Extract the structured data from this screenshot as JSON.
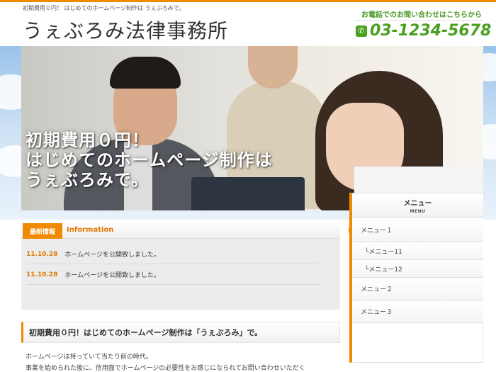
{
  "header": {
    "tagline": "初期費用０円！ はじめてのホームページ制作は うぇぶろみで。",
    "site_title": "うぇぶろみ法律事務所",
    "contact_label": "お電話でのお問い合わせはこちらから",
    "phone_number": "03-1234-5678",
    "phone_icon": "phone-icon"
  },
  "hero": {
    "line1": "初期費用０円！",
    "line2": "はじめてのホームページ制作は",
    "line3": "うぇぶろみで。"
  },
  "news": {
    "tag": "最新情報",
    "subtitle": "Information",
    "items": [
      {
        "date": "11.10.28",
        "text": "ホームページを公開致しました。"
      },
      {
        "date": "11.10.28",
        "text": "ホームページを公開致しました。"
      }
    ]
  },
  "intro": {
    "heading": "初期費用０円！はじめてのホームページ制作は「うぇぶろみ」で。",
    "line1": "ホームページは持っていて当たり前の時代。",
    "line2": "事業を始められた後に、信用面でホームページの必要性をお感じになられてお問い合わせいただく"
  },
  "sidebar": {
    "title": "メニュー",
    "subtitle": "MENU",
    "items": [
      {
        "label": "メニュー１"
      },
      {
        "label": "└メニュー11"
      },
      {
        "label": "└メニュー12"
      },
      {
        "label": "メニュー２"
      },
      {
        "label": "メニュー３"
      }
    ]
  },
  "colors": {
    "accent": "#f08a00",
    "phone_green": "#49a01f"
  }
}
